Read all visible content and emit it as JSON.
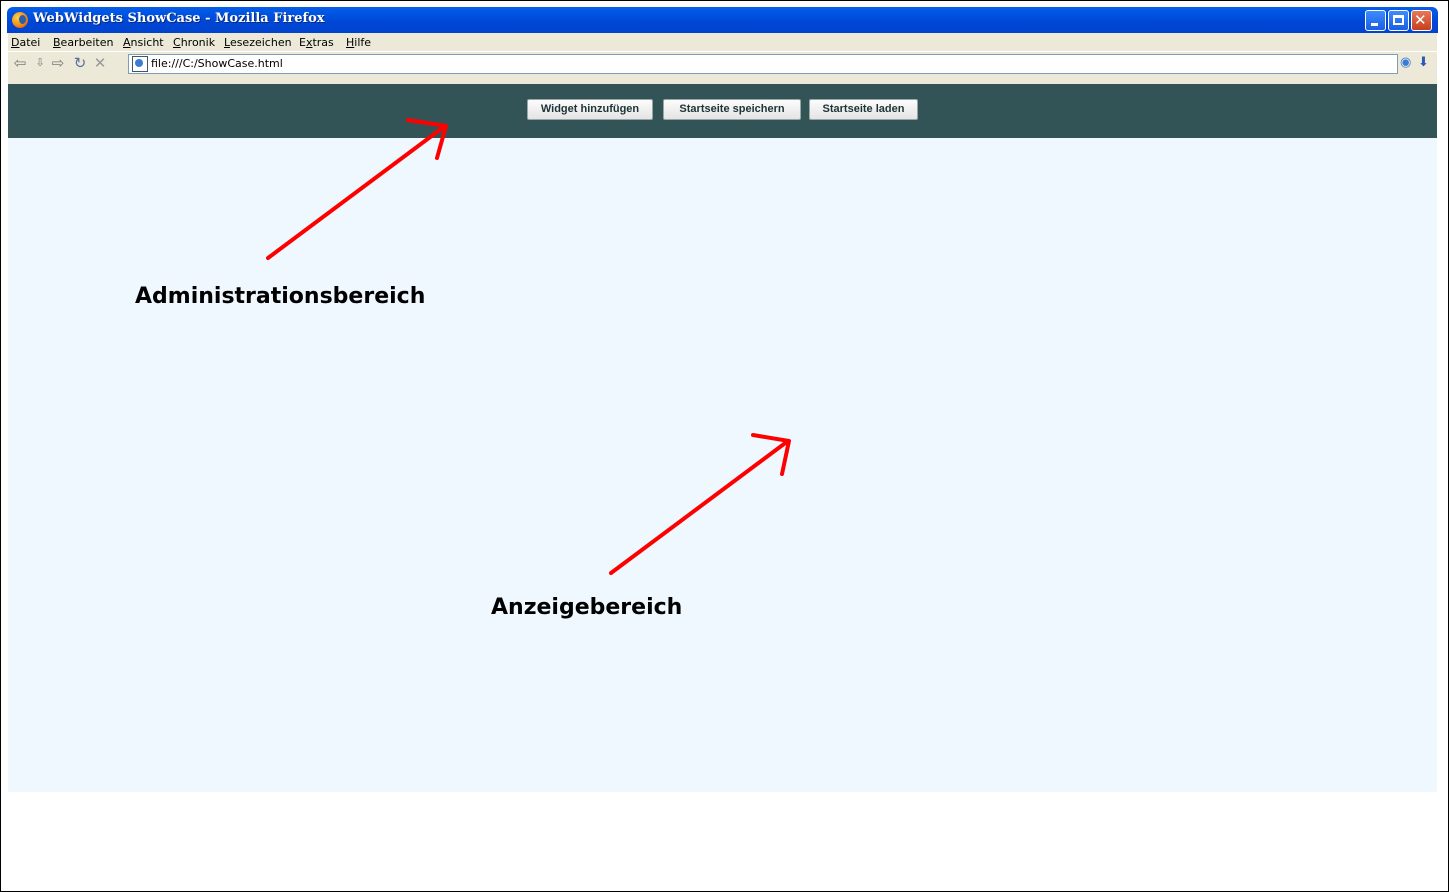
{
  "window": {
    "title": "WebWidgets ShowCase - Mozilla Firefox",
    "controls": [
      "minimize",
      "maximize",
      "close"
    ]
  },
  "menu": {
    "items": [
      {
        "pre": "",
        "key": "D",
        "post": "atei"
      },
      {
        "pre": "",
        "key": "B",
        "post": "earbeiten"
      },
      {
        "pre": "",
        "key": "A",
        "post": "nsicht"
      },
      {
        "pre": "",
        "key": "C",
        "post": "hronik"
      },
      {
        "pre": "",
        "key": "L",
        "post": "esezeichen"
      },
      {
        "pre": "E",
        "key": "x",
        "post": "tras"
      },
      {
        "pre": "",
        "key": "H",
        "post": "ilfe"
      }
    ]
  },
  "navigation": {
    "icons": [
      "back-icon",
      "back-dropdown-icon",
      "forward-icon",
      "reload-icon",
      "stop-icon",
      "page-icon"
    ],
    "url": "file:///C:/ShowCase.html"
  },
  "admin_bar": {
    "buttons": {
      "add_widget": "Widget hinzufügen",
      "save_home": "Startseite speichern",
      "load_home": "Startseite laden"
    },
    "background": "#335457"
  },
  "annotations": {
    "admin_label": "Administrationsbereich",
    "display_label": "Anzeigebereich",
    "arrow_color": "#ff0000"
  },
  "display_area": {
    "background": "#f0f8ff"
  }
}
